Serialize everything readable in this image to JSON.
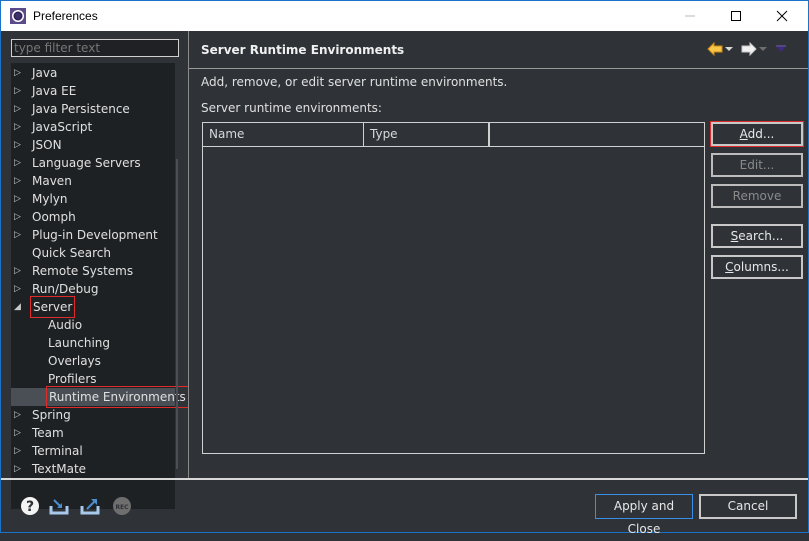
{
  "window": {
    "title": "Preferences",
    "app_icon": "eclipse-gear-icon",
    "controls": [
      "minimize",
      "maximize",
      "close"
    ]
  },
  "sidebar": {
    "filter_placeholder": "type filter text",
    "filter_value": "",
    "items": [
      {
        "label": "Java",
        "expandable": true,
        "level": 0
      },
      {
        "label": "Java EE",
        "expandable": true,
        "level": 0
      },
      {
        "label": "Java Persistence",
        "expandable": true,
        "level": 0
      },
      {
        "label": "JavaScript",
        "expandable": true,
        "level": 0
      },
      {
        "label": "JSON",
        "expandable": true,
        "level": 0
      },
      {
        "label": "Language Servers",
        "expandable": true,
        "level": 0
      },
      {
        "label": "Maven",
        "expandable": true,
        "level": 0
      },
      {
        "label": "Mylyn",
        "expandable": true,
        "level": 0
      },
      {
        "label": "Oomph",
        "expandable": true,
        "level": 0
      },
      {
        "label": "Plug-in Development",
        "expandable": true,
        "level": 0
      },
      {
        "label": "Quick Search",
        "expandable": false,
        "level": 0
      },
      {
        "label": "Remote Systems",
        "expandable": true,
        "level": 0
      },
      {
        "label": "Run/Debug",
        "expandable": true,
        "level": 0
      },
      {
        "label": "Server",
        "expandable": true,
        "expanded": true,
        "level": 0,
        "highlighted": true
      },
      {
        "label": "Audio",
        "expandable": false,
        "level": 1
      },
      {
        "label": "Launching",
        "expandable": false,
        "level": 1
      },
      {
        "label": "Overlays",
        "expandable": false,
        "level": 1
      },
      {
        "label": "Profilers",
        "expandable": false,
        "level": 1
      },
      {
        "label": "Runtime Environments",
        "expandable": false,
        "level": 1,
        "selected": true,
        "highlighted": true
      },
      {
        "label": "Spring",
        "expandable": true,
        "level": 0
      },
      {
        "label": "Team",
        "expandable": true,
        "level": 0
      },
      {
        "label": "Terminal",
        "expandable": true,
        "level": 0
      },
      {
        "label": "TextMate",
        "expandable": true,
        "level": 0
      }
    ]
  },
  "page": {
    "title": "Server Runtime Environments",
    "description": "Add, remove, or edit server runtime environments.",
    "list_label": "Server runtime environments:",
    "table": {
      "columns": [
        "Name",
        "Type",
        ""
      ],
      "rows": []
    },
    "buttons": {
      "add": {
        "label": "Add...",
        "mnemonic": "A",
        "enabled": true,
        "highlighted": true
      },
      "edit": {
        "label": "Edit...",
        "enabled": false
      },
      "remove": {
        "label": "Remove",
        "enabled": false
      },
      "search": {
        "label": "Search...",
        "mnemonic": "S",
        "enabled": true
      },
      "columns": {
        "label": "Columns...",
        "mnemonic": "C",
        "enabled": true
      }
    },
    "nav": [
      "back-arrow-icon",
      "back-menu-icon",
      "forward-arrow-icon",
      "forward-menu-icon",
      "view-menu-icon"
    ]
  },
  "footer": {
    "icons": [
      "help-icon",
      "import-icon",
      "export-icon",
      "record-icon"
    ],
    "apply_close_label": "Apply and Close",
    "cancel_label": "Cancel"
  },
  "colors": {
    "background": "#2f3338",
    "tree_background": "#1e2124",
    "highlight_box": "#e02b2b",
    "focus_border": "#1a73c9",
    "nav_back": "#f0b43c"
  }
}
